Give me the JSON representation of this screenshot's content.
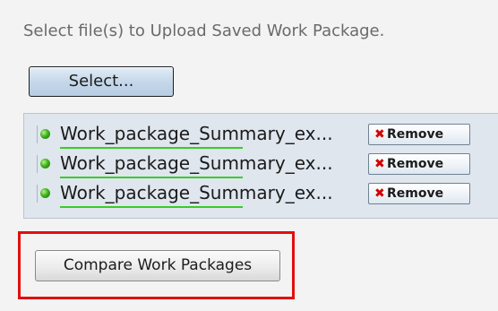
{
  "instruction": "Select file(s) to Upload Saved Work Package.",
  "select_button_label": "Select...",
  "files": [
    {
      "name": "Work_package_Summary_ex...",
      "remove_label": "Remove",
      "upload_progress": 1.0,
      "icon": "status-green-dot"
    },
    {
      "name": "Work_package_Summary_ex...",
      "remove_label": "Remove",
      "upload_progress": 1.0,
      "icon": "status-green-dot"
    },
    {
      "name": "Work_package_Summary_ex...",
      "remove_label": "Remove",
      "upload_progress": 1.0,
      "icon": "status-green-dot"
    }
  ],
  "remove_icon": "x-icon",
  "compare_button_label": "Compare Work Packages",
  "colors": {
    "highlight": "#e10f0f",
    "status_ok": "#3fb21d",
    "remove_x": "#d40000",
    "progress": "#38cc28"
  }
}
